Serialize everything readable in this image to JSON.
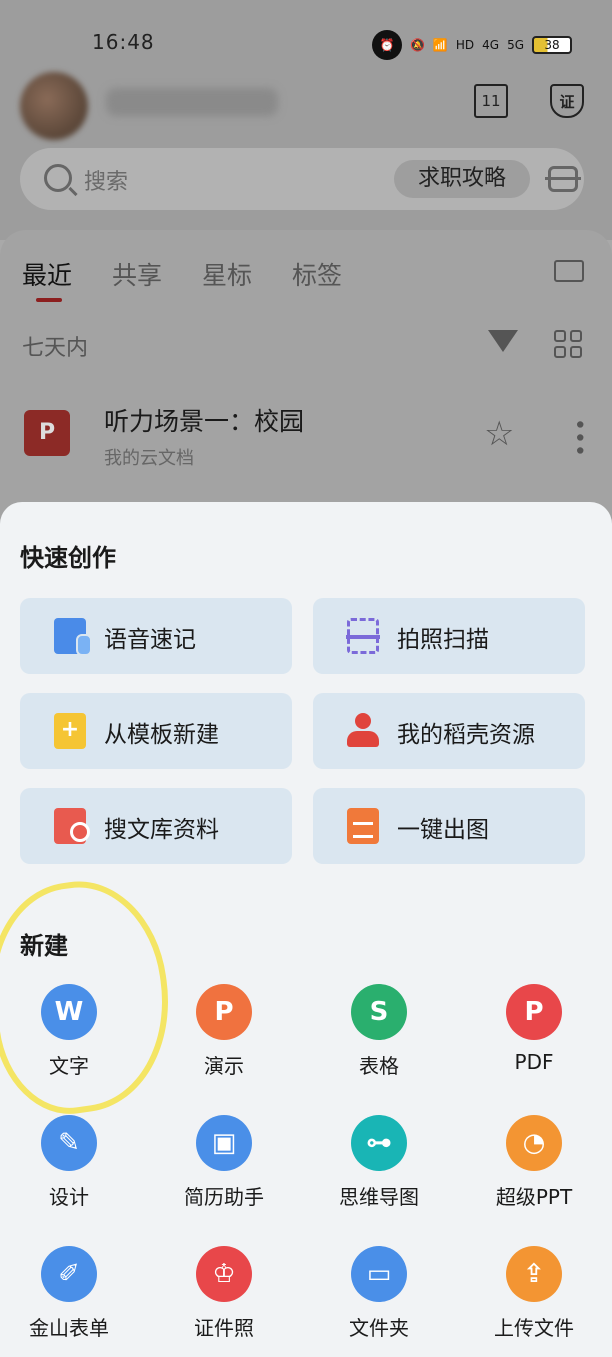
{
  "status_bar": {
    "time": "16:48",
    "hd_label": "HD",
    "net_4g": "4G",
    "net_5g": "5G",
    "battery": "38"
  },
  "header": {
    "calendar_day": "11",
    "shield_label": "证"
  },
  "search": {
    "placeholder": "搜索",
    "pill": "求职攻略"
  },
  "tabs": [
    {
      "label": "最近"
    },
    {
      "label": "共享"
    },
    {
      "label": "星标"
    },
    {
      "label": "标签"
    }
  ],
  "filter_range": "七天内",
  "recent_file": {
    "title": "听力场景一：校园",
    "subtitle": "我的云文档"
  },
  "quick_create": {
    "title": "快速创作",
    "items": [
      {
        "label": "语音速记",
        "icon": "voice-note-icon"
      },
      {
        "label": "拍照扫描",
        "icon": "photo-scan-icon"
      },
      {
        "label": "从模板新建",
        "icon": "template-new-icon"
      },
      {
        "label": "我的稻壳资源",
        "icon": "docer-resources-icon"
      },
      {
        "label": "搜文库资料",
        "icon": "library-search-icon"
      },
      {
        "label": "一键出图",
        "icon": "one-click-image-icon"
      }
    ]
  },
  "new_section": {
    "title": "新建",
    "items": [
      {
        "label": "文字",
        "glyph": "W",
        "color": "#4a8fe8"
      },
      {
        "label": "演示",
        "glyph": "P",
        "color": "#f0723f"
      },
      {
        "label": "表格",
        "glyph": "S",
        "color": "#2aaf6e"
      },
      {
        "label": "PDF",
        "glyph": "P",
        "color": "#e8474a"
      },
      {
        "label": "设计",
        "glyph": "✎",
        "color": "#4a8fe8"
      },
      {
        "label": "简历助手",
        "glyph": "▣",
        "color": "#4a8fe8"
      },
      {
        "label": "思维导图",
        "glyph": "⊶",
        "color": "#19b5b5"
      },
      {
        "label": "超级PPT",
        "glyph": "◔",
        "color": "#f39533"
      },
      {
        "label": "金山表单",
        "glyph": "✐",
        "color": "#4a8fe8"
      },
      {
        "label": "证件照",
        "glyph": "♔",
        "color": "#e8474a"
      },
      {
        "label": "文件夹",
        "glyph": "▭",
        "color": "#4a8fe8"
      },
      {
        "label": "上传文件",
        "glyph": "⇪",
        "color": "#f39533"
      }
    ]
  }
}
